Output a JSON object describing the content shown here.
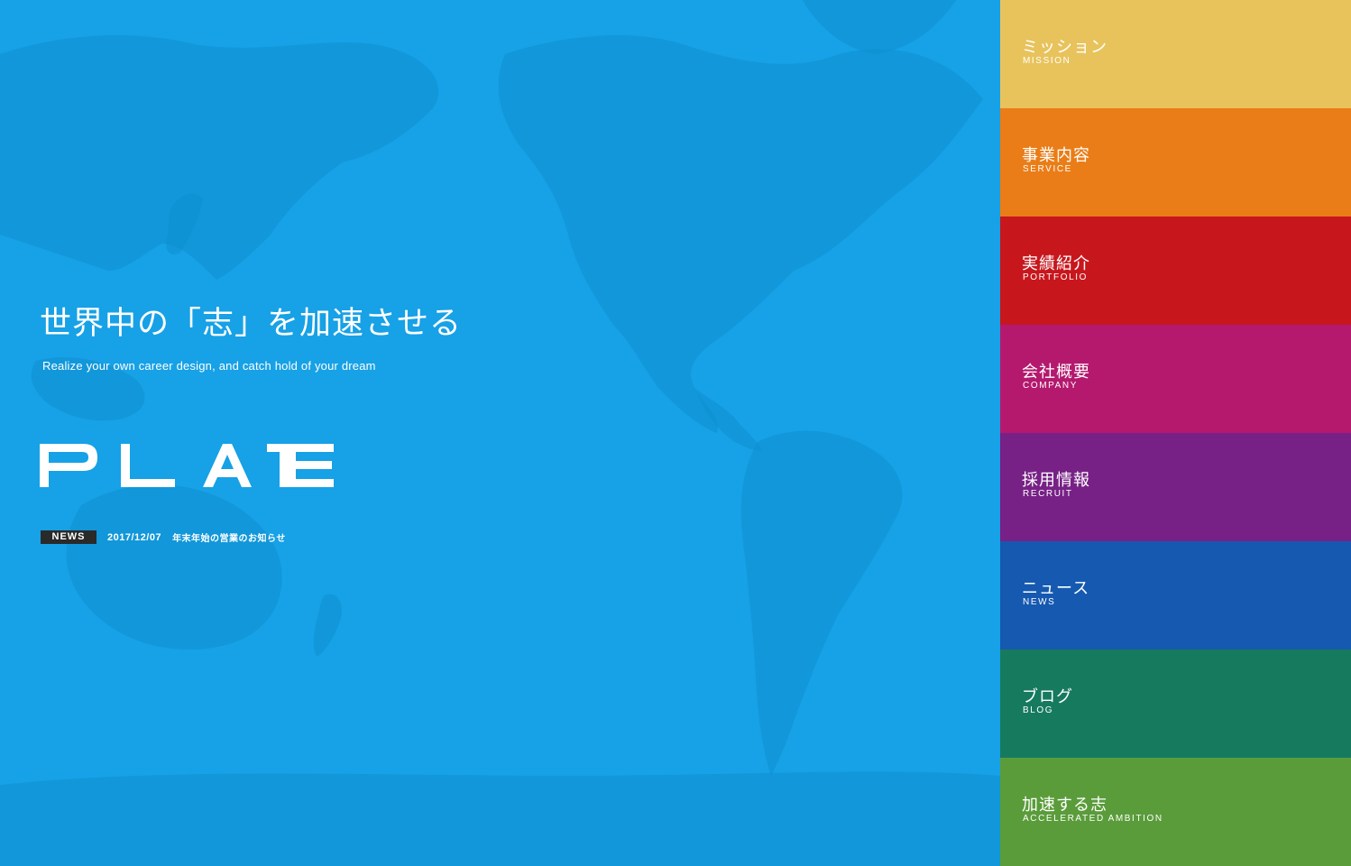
{
  "hero": {
    "headline": "世界中の「志」を加速させる",
    "subline": "Realize your own career design, and catch hold of your dream",
    "logo_text": "PLATE",
    "news": {
      "badge": "NEWS",
      "date": "2017/12/07",
      "title": "年末年始の営業のお知らせ"
    }
  },
  "colors": {
    "background": "#17a1e6",
    "map_land": "#0d8fd0",
    "news_badge": "#2a2a2a"
  },
  "nav": {
    "items": [
      {
        "label_ja": "ミッション",
        "label_en": "MISSION",
        "color": "#e8c35c"
      },
      {
        "label_ja": "事業内容",
        "label_en": "SERVICE",
        "color": "#ea7d17"
      },
      {
        "label_ja": "実績紹介",
        "label_en": "PORTFOLIO",
        "color": "#c7171d"
      },
      {
        "label_ja": "会社概要",
        "label_en": "COMPANY",
        "color": "#b4196e"
      },
      {
        "label_ja": "採用情報",
        "label_en": "RECRUIT",
        "color": "#772186"
      },
      {
        "label_ja": "ニュース",
        "label_en": "NEWS",
        "color": "#1659b0"
      },
      {
        "label_ja": "ブログ",
        "label_en": "BLOG",
        "color": "#167a5f"
      },
      {
        "label_ja": "加速する志",
        "label_en": "ACCELERATED AMBITION",
        "color": "#5a9c3a"
      }
    ]
  }
}
